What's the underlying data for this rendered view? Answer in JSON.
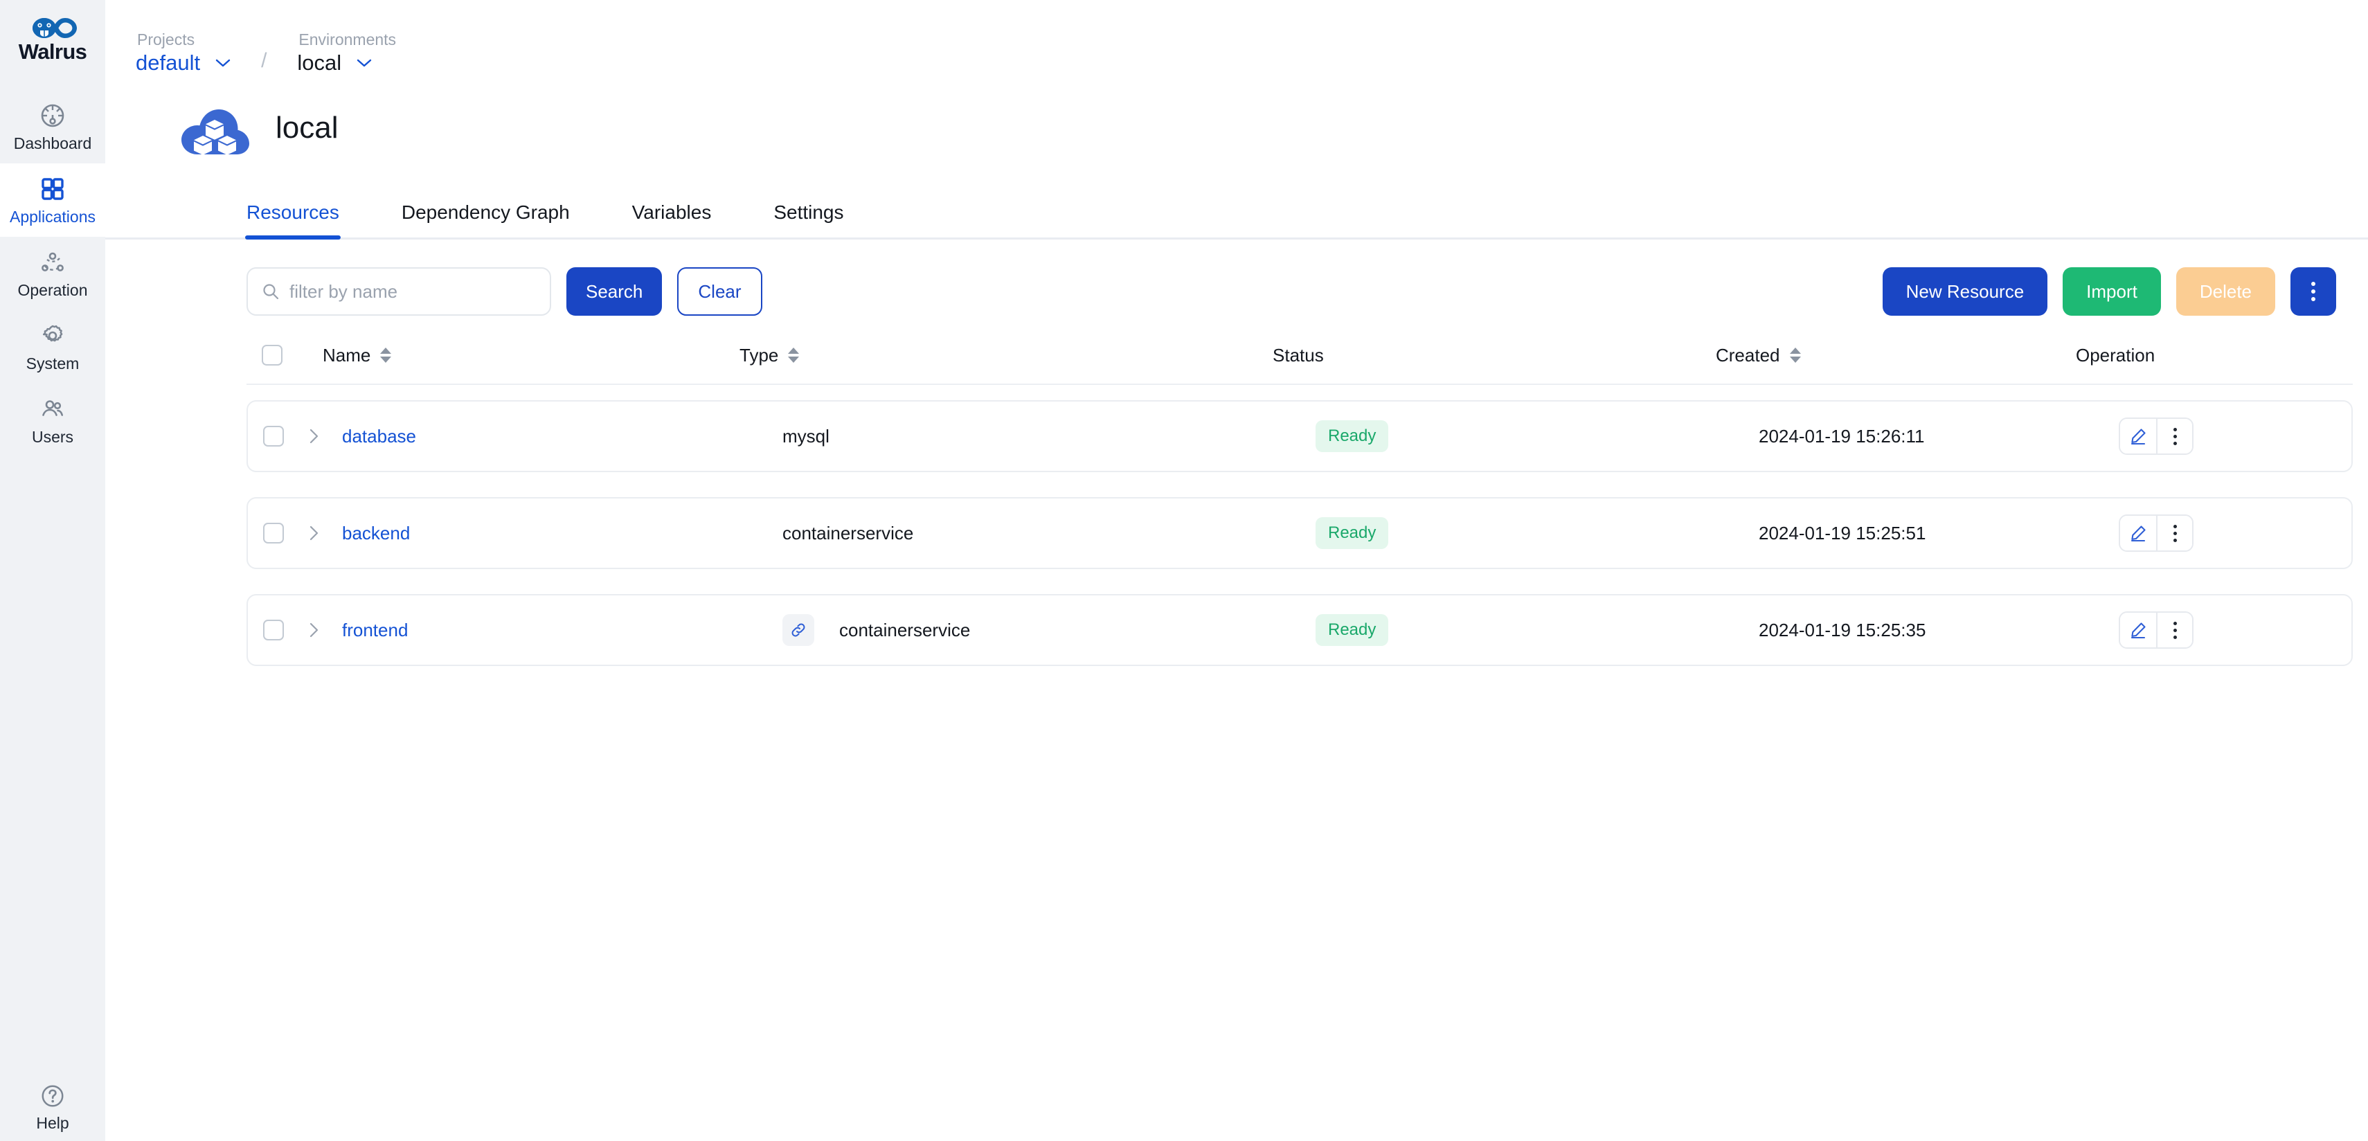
{
  "brand": {
    "name": "Walrus",
    "logo_icon": "walrus-infinity-logo"
  },
  "sidebar": {
    "items": [
      {
        "label": "Dashboard",
        "icon": "dashboard-gauge-icon",
        "active": false
      },
      {
        "label": "Applications",
        "icon": "grid-squares-icon",
        "active": true
      },
      {
        "label": "Operation",
        "icon": "nodes-network-icon",
        "active": false
      },
      {
        "label": "System",
        "icon": "gear-icon",
        "active": false
      },
      {
        "label": "Users",
        "icon": "users-icon",
        "active": false
      }
    ],
    "help": {
      "label": "Help",
      "icon": "question-circle-icon"
    }
  },
  "breadcrumb": {
    "project": {
      "caption": "Projects",
      "value": "default",
      "chevron_icon": "chevron-down-icon"
    },
    "separator": "/",
    "environment": {
      "caption": "Environments",
      "value": "local",
      "chevron_icon": "chevron-down-icon"
    }
  },
  "page": {
    "title": "local",
    "avatar_icon": "cloud-cubes-icon"
  },
  "tabs": [
    {
      "label": "Resources",
      "active": true
    },
    {
      "label": "Dependency Graph",
      "active": false
    },
    {
      "label": "Variables",
      "active": false
    },
    {
      "label": "Settings",
      "active": false
    }
  ],
  "toolbar": {
    "search": {
      "placeholder": "filter by name",
      "value": "",
      "icon": "search-icon"
    },
    "search_button": "Search",
    "clear_button": "Clear",
    "new_resource_button": "New Resource",
    "import_button": "Import",
    "delete_button": "Delete",
    "more_button_icon": "kebab-menu-icon"
  },
  "table": {
    "columns": [
      {
        "label": "Name",
        "sortable": true
      },
      {
        "label": "Type",
        "sortable": true
      },
      {
        "label": "Status",
        "sortable": false
      },
      {
        "label": "Created",
        "sortable": true
      },
      {
        "label": "Operation",
        "sortable": false
      }
    ],
    "rows": [
      {
        "name": "database",
        "type": "mysql",
        "status": "Ready",
        "created": "2024-01-19 15:26:11",
        "has_link_icon": false,
        "checked": false
      },
      {
        "name": "backend",
        "type": "containerservice",
        "status": "Ready",
        "created": "2024-01-19 15:25:51",
        "has_link_icon": false,
        "checked": false
      },
      {
        "name": "frontend",
        "type": "containerservice",
        "status": "Ready",
        "created": "2024-01-19 15:25:35",
        "has_link_icon": true,
        "checked": false
      }
    ],
    "row_actions": {
      "edit_icon": "pencil-edit-icon",
      "more_icon": "kebab-menu-icon"
    }
  },
  "colors": {
    "accent_blue": "#1452d4",
    "button_blue": "#1a46c4",
    "success_green": "#1eb974",
    "badge_green_text": "#1aa86a",
    "badge_green_bg": "#e4f7ed",
    "delete_disabled": "#fbcd93",
    "sidebar_bg": "#f0f2f5"
  }
}
